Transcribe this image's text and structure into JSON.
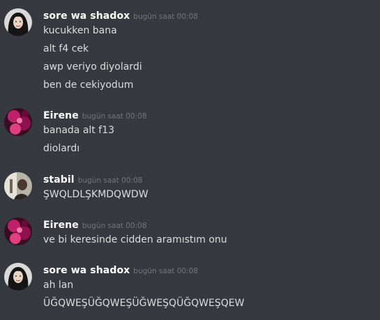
{
  "messages": [
    {
      "author": "sore wa shadox",
      "timestamp": "bugün saat 00:08",
      "avatar": "avatar-dark-hair",
      "lines": [
        "kucukken bana",
        "alt f4 cek",
        "awp veriyo diyolardi",
        "ben de cekiyodum"
      ]
    },
    {
      "author": "Eirene",
      "timestamp": "bugün saat 00:08",
      "avatar": "avatar-magenta",
      "lines": [
        "banada alt f13",
        "diolardı"
      ]
    },
    {
      "author": "stabil",
      "timestamp": "bugün saat 00:08",
      "avatar": "avatar-light-figure",
      "lines": [
        "ŞWQLDLŞKMDQWDW"
      ]
    },
    {
      "author": "Eirene",
      "timestamp": "bugün saat 00:08",
      "avatar": "avatar-magenta",
      "lines": [
        "ve bi keresinde cidden aramıstım onu"
      ]
    },
    {
      "author": "sore wa shadox",
      "timestamp": "bugün saat 00:08",
      "avatar": "avatar-dark-hair",
      "lines": [
        "ah lan",
        "ÜĞQWEŞÜĞQWEŞÜĞWEŞQÜĞQWEŞQEW"
      ]
    }
  ],
  "colors": {
    "background": "#36393f",
    "username": "#ffffff",
    "timestamp": "#72767d",
    "text": "#dcddde"
  }
}
